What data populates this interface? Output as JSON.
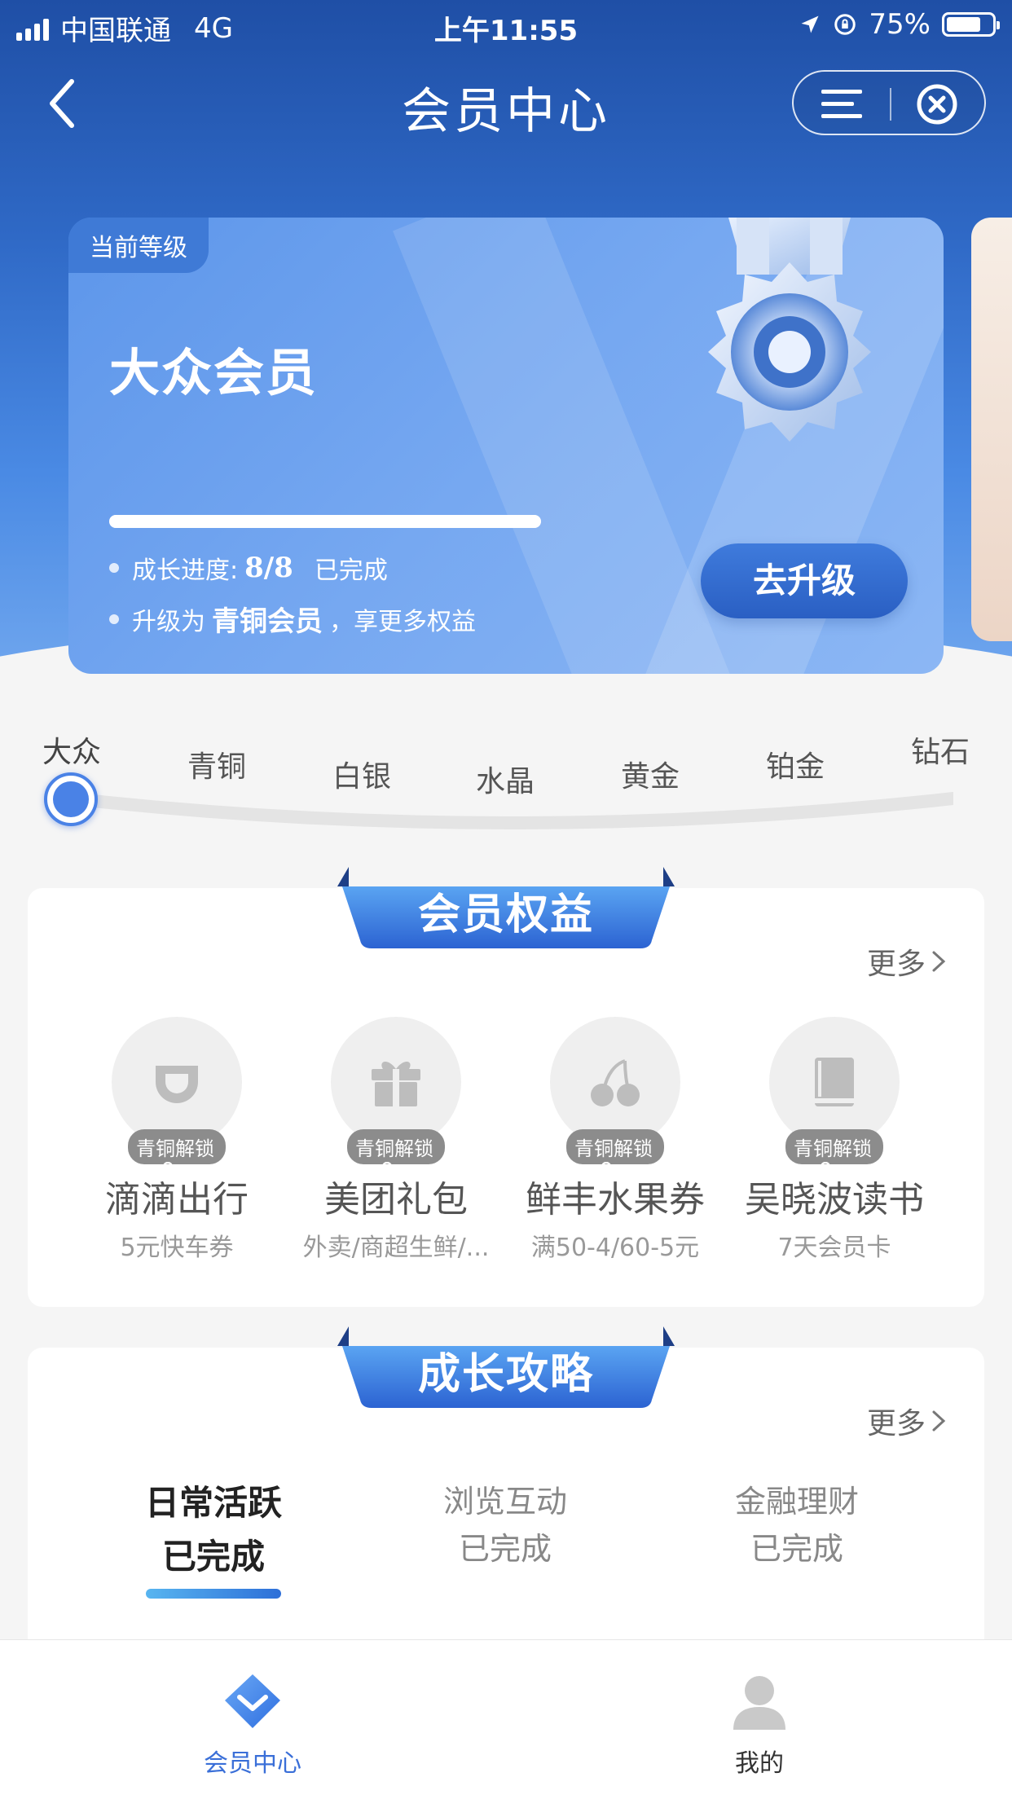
{
  "status_bar": {
    "carrier": "中国联通",
    "network": "4G",
    "time": "上午11:55",
    "battery_pct": "75%",
    "battery_level": 0.75
  },
  "nav": {
    "title": "会员中心",
    "back_icon": "chevron-left-icon",
    "menu_icon": "menu-icon",
    "close_icon": "close-circle-icon"
  },
  "level_card": {
    "tag": "当前等级",
    "level_name": "大众会员",
    "progress_label": "成长进度:",
    "progress_value": "8/8",
    "progress_status": "已完成",
    "progress_fraction": 1.0,
    "upgrade_prefix": "升级为",
    "upgrade_target": "青铜会员",
    "upgrade_suffix": "，享更多权益",
    "upgrade_button": "去升级",
    "medal_icon": "medal-icon"
  },
  "levels": [
    {
      "label": "大众"
    },
    {
      "label": "青铜"
    },
    {
      "label": "白银"
    },
    {
      "label": "水晶"
    },
    {
      "label": "黄金"
    },
    {
      "label": "铂金"
    },
    {
      "label": "钻石"
    }
  ],
  "benefits_section": {
    "title": "会员权益",
    "more": "更多",
    "items": [
      {
        "icon": "didi-icon",
        "lock": "青铜解锁",
        "name": "滴滴出行",
        "desc": "5元快车券"
      },
      {
        "icon": "gift-icon",
        "lock": "青铜解锁",
        "name": "美团礼包",
        "desc": "外卖/商超生鲜/..."
      },
      {
        "icon": "cherry-icon",
        "lock": "青铜解锁",
        "name": "鲜丰水果券",
        "desc": "满50-4/60-5元"
      },
      {
        "icon": "book-icon",
        "lock": "青铜解锁",
        "name": "吴晓波读书",
        "desc": "7天会员卡"
      }
    ]
  },
  "growth_section": {
    "title": "成长攻略",
    "more": "更多",
    "tabs": [
      {
        "title": "日常活跃",
        "status": "已完成"
      },
      {
        "title": "浏览互动",
        "status": "已完成"
      },
      {
        "title": "金融理财",
        "status": "已完成"
      }
    ]
  },
  "tabbar": {
    "items": [
      {
        "label": "会员中心",
        "icon": "diamond-icon",
        "color": "#3a6fd8"
      },
      {
        "label": "我的",
        "icon": "user-icon",
        "color": "#333333"
      }
    ]
  },
  "colors": {
    "accent": "#3a6fd8",
    "header_bg": "#2a5fbd"
  }
}
